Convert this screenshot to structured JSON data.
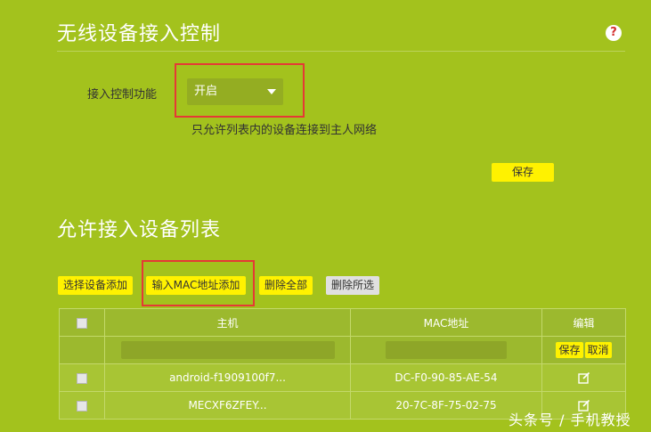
{
  "access_control": {
    "title": "无线设备接入控制",
    "help_icon": "help-icon",
    "help_glyph": "?",
    "function_label": "接入控制功能",
    "select_value": "开启",
    "description": "只允许列表内的设备连接到主人网络",
    "save_label": "保存"
  },
  "allowed_list": {
    "title": "允许接入设备列表",
    "buttons": {
      "select_add": "选择设备添加",
      "input_mac_add": "输入MAC地址添加",
      "delete_all": "删除全部",
      "delete_selected": "删除所选"
    },
    "table": {
      "headers": [
        "主机",
        "MAC地址",
        "编辑"
      ],
      "input_row": {
        "save": "保存",
        "cancel": "取消"
      },
      "rows": [
        {
          "host": "android-f1909100f7...",
          "mac": "DC-F0-90-85-AE-54"
        },
        {
          "host": "MECXF6ZFEY...",
          "mac": "20-7C-8F-75-02-75"
        }
      ]
    }
  },
  "watermark": "头条号 / 手机教授",
  "colors": {
    "background": "#a3c21d",
    "button": "#fff200",
    "highlight": "#e53935"
  }
}
